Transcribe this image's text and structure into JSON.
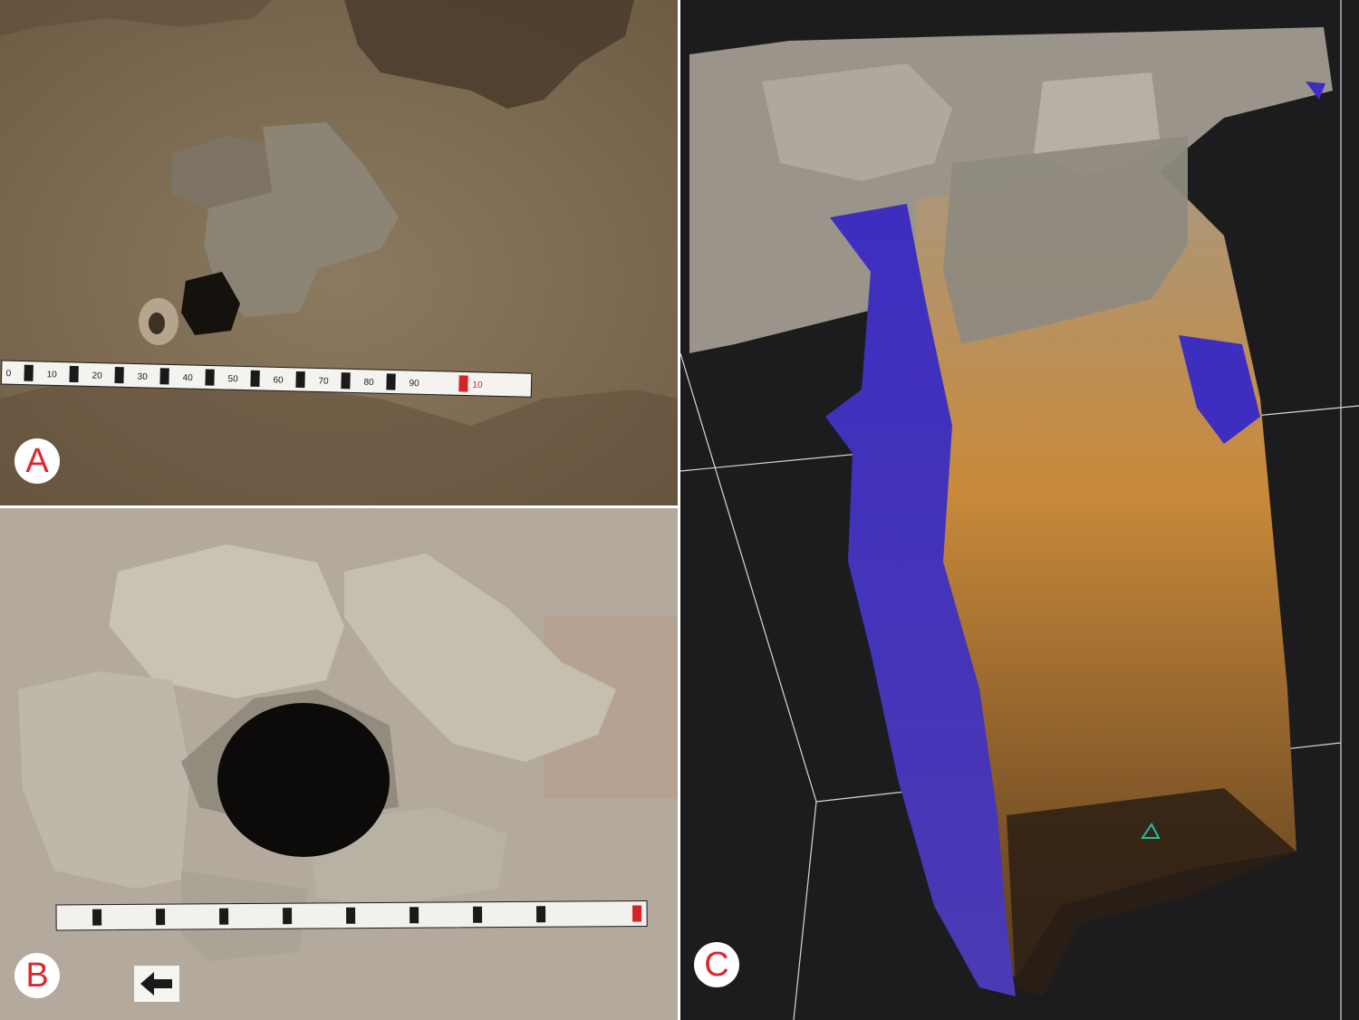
{
  "panels": [
    {
      "label": "A"
    },
    {
      "label": "B"
    },
    {
      "label": "C"
    }
  ],
  "scale_bar_a": {
    "numbers": [
      "0",
      "10",
      "20",
      "30",
      "40",
      "50",
      "60",
      "70",
      "80",
      "90",
      "10"
    ]
  },
  "colors": {
    "soil": "#8a7559",
    "stone": "#a9a295",
    "pale_soil": "#b3aa9d",
    "viewer_bg": "#1c1c1e",
    "mesh_blue": "#3d2ec0",
    "mesh_orange": "#c98a3a",
    "label_red": "#e0262e"
  }
}
